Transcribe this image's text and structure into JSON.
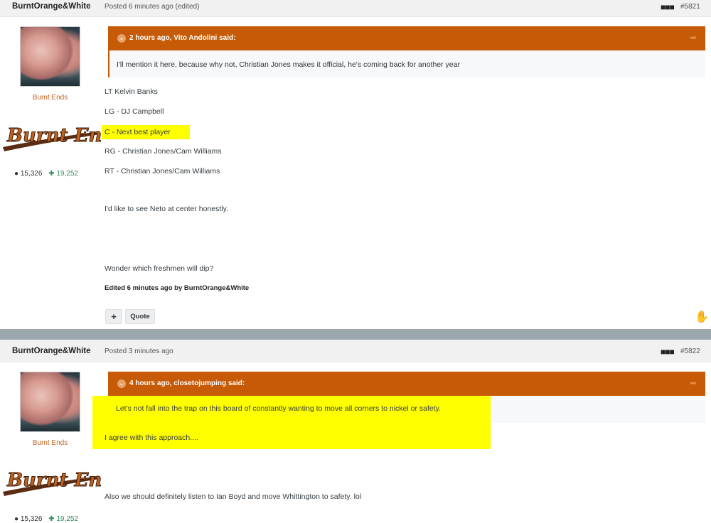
{
  "post1": {
    "author": "BurntOrange&White",
    "posted": "Posted 6 minutes ago (edited)",
    "number": "#5821",
    "rank": "Burnt Ends",
    "logo_text": "Burnt Ends",
    "stats": {
      "posts": "15,326",
      "rep": "19,252"
    },
    "quote": {
      "header": "2 hours ago, Vito Andolini said:",
      "body": "I'll mention it here, because why not, Christian Jones makes it official, he's coming back for another year"
    },
    "lines": [
      "LT Kelvin Banks",
      "LG - DJ Campbell",
      "C - Next best player",
      "RG - Christian Jones/Cam Williams",
      "RT - Christian Jones/Cam Williams",
      "I'd like to see Neto at center honestly.",
      "Wonder which freshmen will dip?"
    ],
    "edited": "Edited 6 minutes ago by BurntOrange&White",
    "plus_label": "+",
    "quote_label": "Quote"
  },
  "post2": {
    "author": "BurntOrange&White",
    "posted": "Posted 3 minutes ago",
    "number": "#5822",
    "rank": "Burnt Ends",
    "logo_text": "Burnt Ends",
    "stats": {
      "posts": "15,326",
      "rep": "19,252"
    },
    "quote": {
      "header": "4 hours ago, closetojumping said:",
      "body": "Let's not fall into the trap on this board of constantly wanting to move all corners to nickel or safety."
    },
    "lines": [
      "I agree with this approach....",
      "Also we should definitely listen to Ian Boyd and move Whittington to safety. lol"
    ]
  },
  "colors": {
    "accent": "#c65a06",
    "highlight": "#ffff00",
    "rank": "#c0611e",
    "rep": "#2e8b57"
  }
}
